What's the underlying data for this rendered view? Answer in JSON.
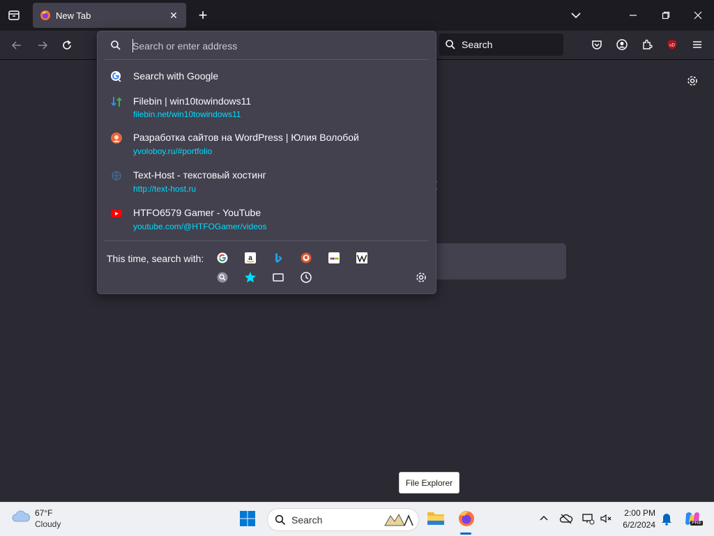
{
  "tab": {
    "title": "New Tab",
    "close": "✕"
  },
  "toolbar": {
    "new_tab": "+"
  },
  "search_box": {
    "label": "Search"
  },
  "urlbar": {
    "placeholder": "Search or enter address"
  },
  "suggestions": [
    {
      "title": "Search with Google",
      "url": ""
    },
    {
      "title": "Filebin | win10towindows11",
      "url": "filebin.net/win10towindows11"
    },
    {
      "title": "Разработка сайтов на WordPress | Юлия Волобой",
      "url": "yvoloboy.ru/#portfolio"
    },
    {
      "title": "Text-Host - текстовый хостинг",
      "url": "http://text-host.ru"
    },
    {
      "title": "HTFO6579 Gamer - YouTube",
      "url": "youtube.com/@HTFOGamer/videos"
    }
  ],
  "one_off": {
    "label": "This time, search with:"
  },
  "tooltip": "File Explorer",
  "taskbar": {
    "weather_temp": "67°F",
    "weather_desc": "Cloudy",
    "search_label": "Search",
    "time": "2:00 PM",
    "date": "6/2/2024",
    "copilot_badge": "PRE"
  },
  "colors": {
    "accent_url": "#00ddff",
    "tab_active": "#42414d",
    "chrome_dark": "#1c1b22"
  }
}
